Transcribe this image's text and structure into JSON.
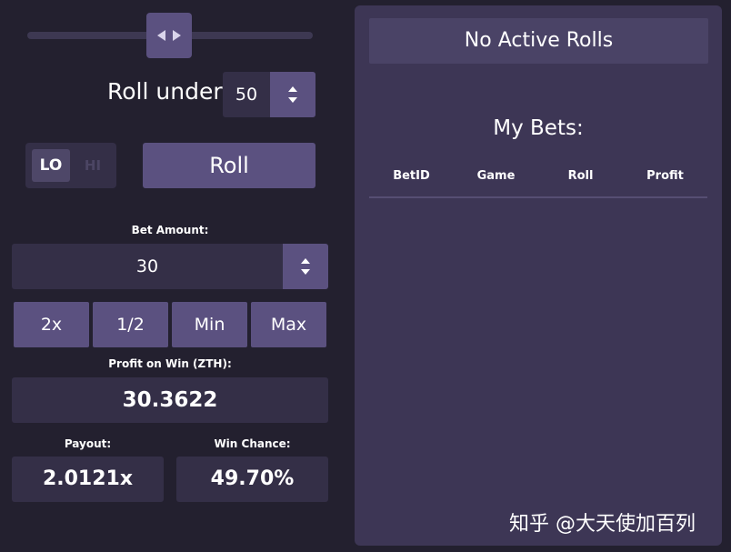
{
  "slider": {
    "value_fraction": 0.5
  },
  "roll_under": {
    "label": "Roll under:",
    "value": "50"
  },
  "direction_toggle": {
    "lo_label": "LO",
    "hi_label": "HI",
    "selected": "LO"
  },
  "roll_button": {
    "label": "Roll"
  },
  "bet": {
    "label": "Bet Amount:",
    "value": "30"
  },
  "quick_buttons": [
    "2x",
    "1/2",
    "Min",
    "Max"
  ],
  "profit": {
    "label": "Profit on Win (ZTH):",
    "value": "30.3622"
  },
  "payout": {
    "label": "Payout:",
    "value": "2.0121x"
  },
  "win_chance": {
    "label": "Win Chance:",
    "value": "49.70%"
  },
  "active_rolls": {
    "label": "No Active Rolls"
  },
  "my_bets": {
    "title": "My Bets:",
    "columns": [
      "BetID",
      "Game",
      "Roll",
      "Profit"
    ]
  },
  "watermark": {
    "text": "知乎 @大天使加百列"
  },
  "colors": {
    "background": "#23202f",
    "panel": "#3d3655",
    "button": "#5b5180",
    "input": "#342f47"
  }
}
